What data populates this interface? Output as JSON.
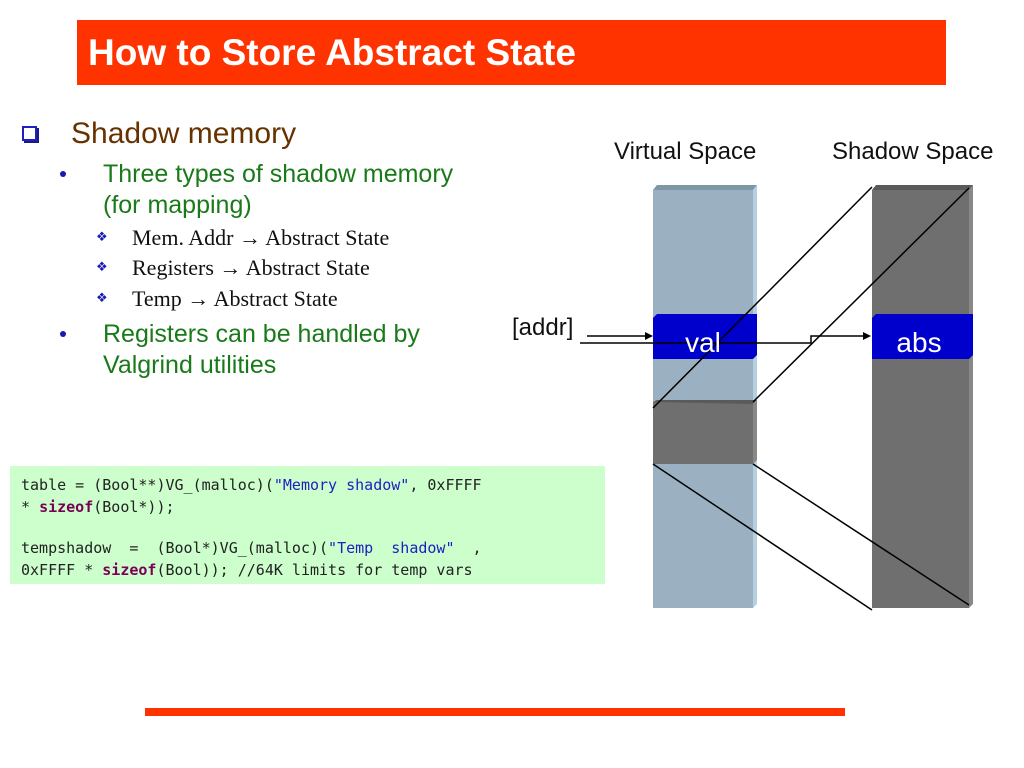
{
  "slide": {
    "title": "How to Store Abstract State",
    "accent_color": "#ff3300",
    "heading": "Shadow memory",
    "bullets": [
      {
        "text_line1": "Three types of shadow memory",
        "text_line2": "(for mapping)",
        "sub": [
          {
            "from": "Mem. Addr",
            "arrow": "→",
            "to": "Abstract State"
          },
          {
            "from": "Registers",
            "arrow": "→",
            "to": "Abstract State"
          },
          {
            "from": "Temp",
            "arrow": "→",
            "to": "Abstract State"
          }
        ]
      },
      {
        "text_line1": "Registers can be handled by",
        "text_line2": "Valgrind utilities"
      }
    ],
    "code": {
      "l1a": "table = (Bool**)VG_(malloc)(",
      "l1s": "\"Memory shadow\"",
      "l1b": ", 0xFFFF",
      "l2a": "* ",
      "l2k": "sizeof",
      "l2b": "(Bool*));",
      "l3a": "tempshadow  =  (Bool*)VG_(malloc)(",
      "l3s": "\"Temp  shadow\"",
      "l3b": "  ,",
      "l4a": "0xFFFF * ",
      "l4k": "sizeof",
      "l4b": "(Bool)); //64K limits for temp vars"
    },
    "diagram": {
      "virtual_label": "Virtual Space",
      "shadow_label": "Shadow Space",
      "addr_label": "[addr]",
      "val_label": "val",
      "abs_label": "abs"
    }
  }
}
